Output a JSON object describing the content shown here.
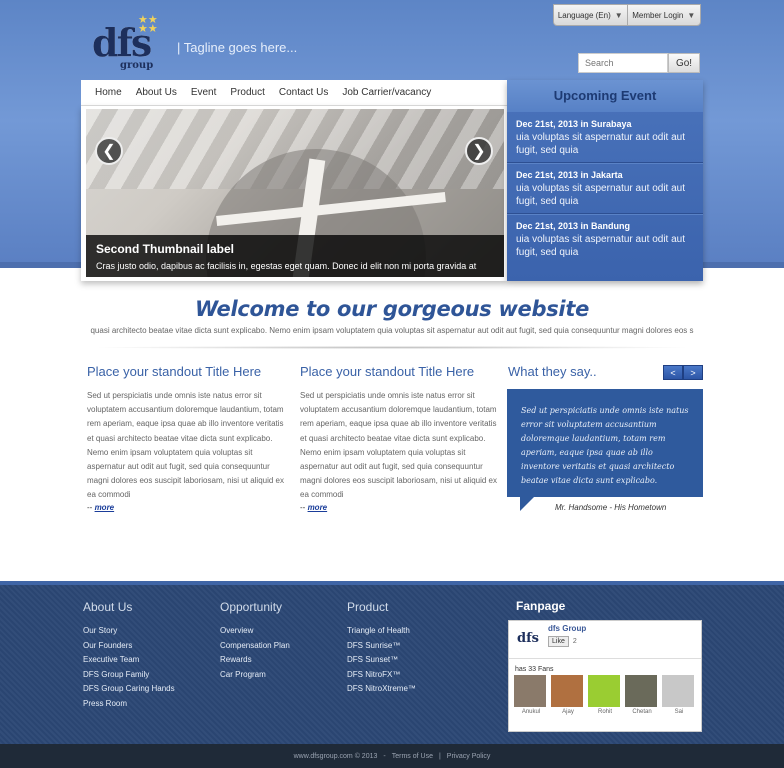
{
  "topbar": {
    "language": "Language (En)",
    "member_login": "Member Login"
  },
  "logo": {
    "main": "dfs",
    "sub": "group"
  },
  "tagline": "| Tagline goes here...",
  "search": {
    "placeholder": "Search",
    "button": "Go!"
  },
  "nav": [
    "Home",
    "About Us",
    "Event",
    "Product",
    "Contact Us",
    "Job Carrier/vacancy"
  ],
  "slider": {
    "caption_title": "Second Thumbnail label",
    "caption_text": "Cras justo odio, dapibus ac facilisis in, egestas eget quam. Donec id elit non mi porta gravida at",
    "prev": "❮",
    "next": "❯"
  },
  "events": {
    "title": "Upcoming Event",
    "items": [
      {
        "date": "Dec 21st, 2013 in Surabaya",
        "text": "uia voluptas sit aspernatur aut odit aut fugit, sed quia"
      },
      {
        "date": "Dec 21st, 2013 in Jakarta",
        "text": "uia voluptas sit aspernatur aut odit aut fugit, sed quia"
      },
      {
        "date": "Dec 21st, 2013 in Bandung",
        "text": "uia voluptas sit aspernatur aut odit aut fugit, sed quia"
      }
    ]
  },
  "welcome": {
    "title": "Welcome to our gorgeous website",
    "subtitle": "quasi architecto beatae vitae dicta sunt explicabo. Nemo enim ipsam voluptatem quia voluptas sit aspernatur aut odit aut fugit, sed quia consequuntur magni dolores eos s"
  },
  "columns": [
    {
      "title": "Place your standout Title Here",
      "body": "Sed ut perspiciatis unde omnis iste natus error sit voluptatem accusantium doloremque laudantium, totam rem aperiam, eaque ipsa quae ab illo inventore veritatis et quasi architecto beatae vitae dicta sunt explicabo. Nemo enim ipsam voluptatem quia voluptas sit aspernatur aut odit aut fugit, sed quia consequuntur magni dolores eos suscipit laboriosam, nisi ut aliquid ex ea commodi",
      "more_prefix": "-- ",
      "more": "more"
    },
    {
      "title": "Place your standout Title Here",
      "body": "Sed ut perspiciatis unde omnis iste natus error sit voluptatem accusantium doloremque laudantium, totam rem aperiam, eaque ipsa quae ab illo inventore veritatis et quasi architecto beatae vitae dicta sunt explicabo. Nemo enim ipsam voluptatem quia voluptas sit aspernatur aut odit aut fugit, sed quia consequuntur magni dolores eos suscipit laboriosam, nisi ut aliquid ex ea commodi",
      "more_prefix": "-- ",
      "more": "more"
    }
  ],
  "testimonial": {
    "title": "What they say..",
    "prev": "<",
    "next": ">",
    "quote": "Sed ut perspiciatis unde omnis iste natus error sit voluptatem accusantium doloremque laudantium, totam rem aperiam, eaque ipsa quae ab illo inventore veritatis et quasi architecto beatae vitae dicta sunt explicabo.",
    "author": "Mr. Handsome - His Hometown"
  },
  "footer": {
    "about": {
      "title": "About Us",
      "links": [
        "Our Story",
        "Our Founders",
        "Executive Team",
        "DFS Group Family",
        "DFS Group Caring Hands",
        "Press Room"
      ]
    },
    "opportunity": {
      "title": "Opportunity",
      "links": [
        "Overview",
        "Compensation Plan",
        "Rewards",
        "Car Program"
      ]
    },
    "product": {
      "title": "Product",
      "links": [
        "Triangle of Health",
        "DFS Sunrise™",
        "DFS Sunset™",
        "DFS NitroFX™",
        "DFS NitroXtreme™"
      ]
    },
    "fanpage": {
      "title": "Fanpage",
      "name": "dfs Group",
      "logo": "dfs",
      "like": "Like",
      "like_count": "2",
      "fans": "has 33 Fans",
      "faces": [
        "Anukul",
        "Ajay",
        "Rohit",
        "Chetan",
        "Sai"
      ]
    }
  },
  "bottom": {
    "copyright": "www.dfsgroup.com © 2013",
    "sep": "-",
    "terms": "Terms of Use",
    "pipe": "|",
    "privacy": "Privacy Policy"
  }
}
